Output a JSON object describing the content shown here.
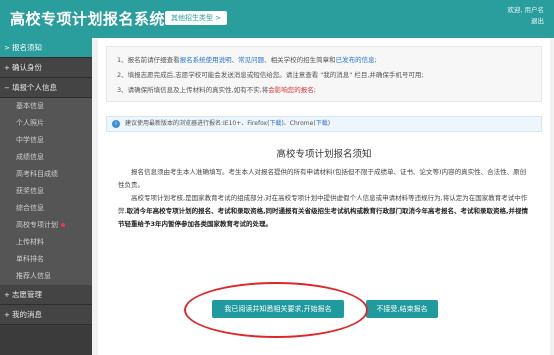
{
  "header": {
    "title": "高校专项计划报名系统",
    "type_button": "其他招生类型 >",
    "welcome": "欢迎,",
    "username": "用户名",
    "logout": "退出"
  },
  "sidebar": {
    "items": [
      {
        "label": "报名须知",
        "indicator": ">",
        "active": true
      },
      {
        "label": "确认身份",
        "indicator": "+"
      },
      {
        "label": "填报个人信息",
        "indicator": "−"
      }
    ],
    "sub_items": [
      {
        "label": "基本信息"
      },
      {
        "label": "个人照片"
      },
      {
        "label": "中学信息"
      },
      {
        "label": "成绩信息"
      },
      {
        "label": "高考科目成绩"
      },
      {
        "label": "获奖信息"
      },
      {
        "label": "综合信息"
      },
      {
        "label": "高校专项计划",
        "dot": true
      },
      {
        "label": "上传材料"
      },
      {
        "label": "单科排名"
      },
      {
        "label": "推荐人信息"
      }
    ],
    "bottom_items": [
      {
        "label": "志愿管理",
        "indicator": "+"
      },
      {
        "label": "我的消息",
        "indicator": "+"
      }
    ]
  },
  "notice": {
    "line1_prefix": "1、报名前请仔细查看",
    "line1_link1": "报名系统使用说明",
    "line1_sep": "、",
    "line1_link2": "常见问题",
    "line1_mid": "、相关学校的招生简章和",
    "line1_link3": "已发布的信息",
    "line1_suffix": ";",
    "line2": "2、填报志愿完成后,志愿学校可能会发送消息或短信给您。请注意查看 \"我的消息\" 栏目,并确保手机号可用;",
    "line3_prefix": "3、请确保所填信息及上传材料的真实性,如有不实,将",
    "line3_red": "会影响您的报名",
    "line3_suffix": ";"
  },
  "browser_bar": {
    "icon": "info-icon",
    "text_prefix": "建议使用最新版本的浏览器进行报名:IE10+、Firefox(",
    "link1": "下载",
    "text_mid": ")、Chrome(",
    "link2": "下载",
    "text_suffix": ")"
  },
  "doc": {
    "title": "高校专项计划报名须知",
    "para1": "报名信息须由考生本人准确填写。考生本人对报名提供的所有申请材料(包括但不限于成绩单、证书、论文等)内容的真实性、合法性、原创性负责。",
    "para2_normal": "高校专项计划考核,是国家教育考试的组成部分,对在高校专项计划中提供虚假个人信息或申请材料等违规行为,将认定为在国家教育考试中作弊,",
    "para2_bold": "取消今年高校专项计划的报名、考试和录取资格,同时通报有关省级招生考试机构或教育行政部门取消今年高考报名、考试和录取资格,并视情节轻重给予3年内暂停参加各类国家教育考试的处理。"
  },
  "buttons": {
    "agree": "我已阅读并知悉相关要求,开始报名",
    "decline": "不接受,结束报名"
  },
  "colors": {
    "brand": "#2a9d9d",
    "sidebar_bg": "#3b3b3b",
    "highlight": "#e0262a",
    "link": "#2874d6"
  }
}
